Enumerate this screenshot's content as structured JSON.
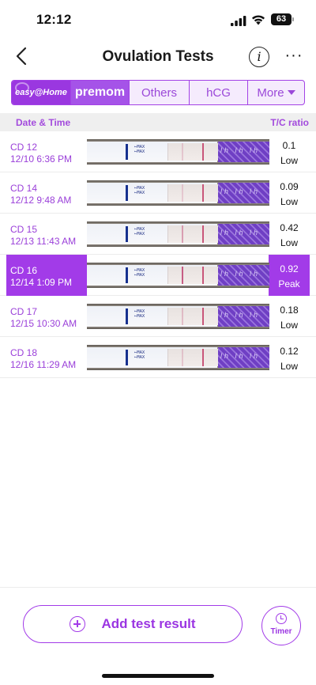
{
  "status_bar": {
    "time": "12:12",
    "battery": "63"
  },
  "nav": {
    "title": "Ovulation Tests",
    "info_glyph": "i",
    "more_glyph": "···"
  },
  "brand_tabs": [
    {
      "label": "easy@Home",
      "selected": true
    },
    {
      "label": "premom",
      "selected": true
    },
    {
      "label": "Others",
      "selected": false
    },
    {
      "label": "hCG",
      "selected": false
    },
    {
      "label": "More",
      "selected": false
    }
  ],
  "table_header": {
    "date_time": "Date & Time",
    "tc_ratio": "T/C ratio"
  },
  "rows": [
    {
      "cd": "CD 12",
      "datetime": "12/10 6:36 PM",
      "ratio": "0.1",
      "level": "Low",
      "selected": false,
      "t_line_strength": 0.1
    },
    {
      "cd": "CD 14",
      "datetime": "12/12 9:48 AM",
      "ratio": "0.09",
      "level": "Low",
      "selected": false,
      "t_line_strength": 0.09
    },
    {
      "cd": "CD 15",
      "datetime": "12/13 11:43 AM",
      "ratio": "0.42",
      "level": "Low",
      "selected": false,
      "t_line_strength": 0.42
    },
    {
      "cd": "CD 16",
      "datetime": "12/14 1:09 PM",
      "ratio": "0.92",
      "level": "Peak",
      "selected": true,
      "t_line_strength": 0.92
    },
    {
      "cd": "CD 17",
      "datetime": "12/15 10:30 AM",
      "ratio": "0.18",
      "level": "Low",
      "selected": false,
      "t_line_strength": 0.18
    },
    {
      "cd": "CD 18",
      "datetime": "12/16 11:29 AM",
      "ratio": "0.12",
      "level": "Low",
      "selected": false,
      "t_line_strength": 0.12
    }
  ],
  "strip_text": {
    "max_label": "MAX",
    "handle_text": "lh lh lh"
  },
  "bottom": {
    "add_label": "Add test result",
    "timer_label": "Timer"
  },
  "colors": {
    "accent": "#a23be8",
    "accent_text": "#9a3fd9",
    "header_bg": "#efefef"
  },
  "icons": [
    "signal-icon",
    "wifi-icon",
    "battery-icon",
    "back-icon",
    "info-icon",
    "more-icon",
    "plus-icon",
    "clock-icon"
  ]
}
